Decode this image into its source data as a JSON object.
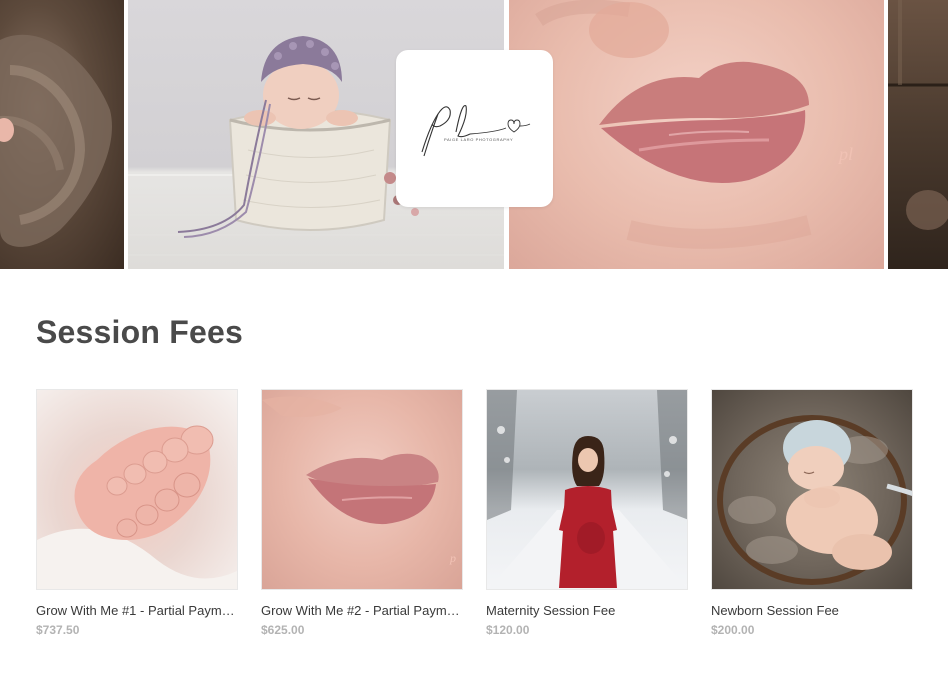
{
  "hero": {
    "logo": {
      "script_text": "pl",
      "tagline": "PAIGE LARO PHOTOGRAPHY"
    },
    "panels": [
      {
        "description_icon": "photo-blanket-icon"
      },
      {
        "description_icon": "photo-baby-basket-icon"
      },
      {
        "description_icon": "photo-baby-lips-icon"
      },
      {
        "description_icon": "photo-wood-icon"
      }
    ]
  },
  "section": {
    "title": "Session Fees"
  },
  "products": [
    {
      "name": "Grow With Me #1 - Partial Payme...",
      "price": "$737.50"
    },
    {
      "name": "Grow With Me #2 - Partial Payme...",
      "price": "$625.00"
    },
    {
      "name": "Maternity Session Fee",
      "price": "$120.00"
    },
    {
      "name": "Newborn Session Fee",
      "price": "$200.00"
    }
  ],
  "colors": {
    "heading": "#4a4a4a",
    "price": "#b3b3b3",
    "maternity_dress": "#b3202c"
  }
}
